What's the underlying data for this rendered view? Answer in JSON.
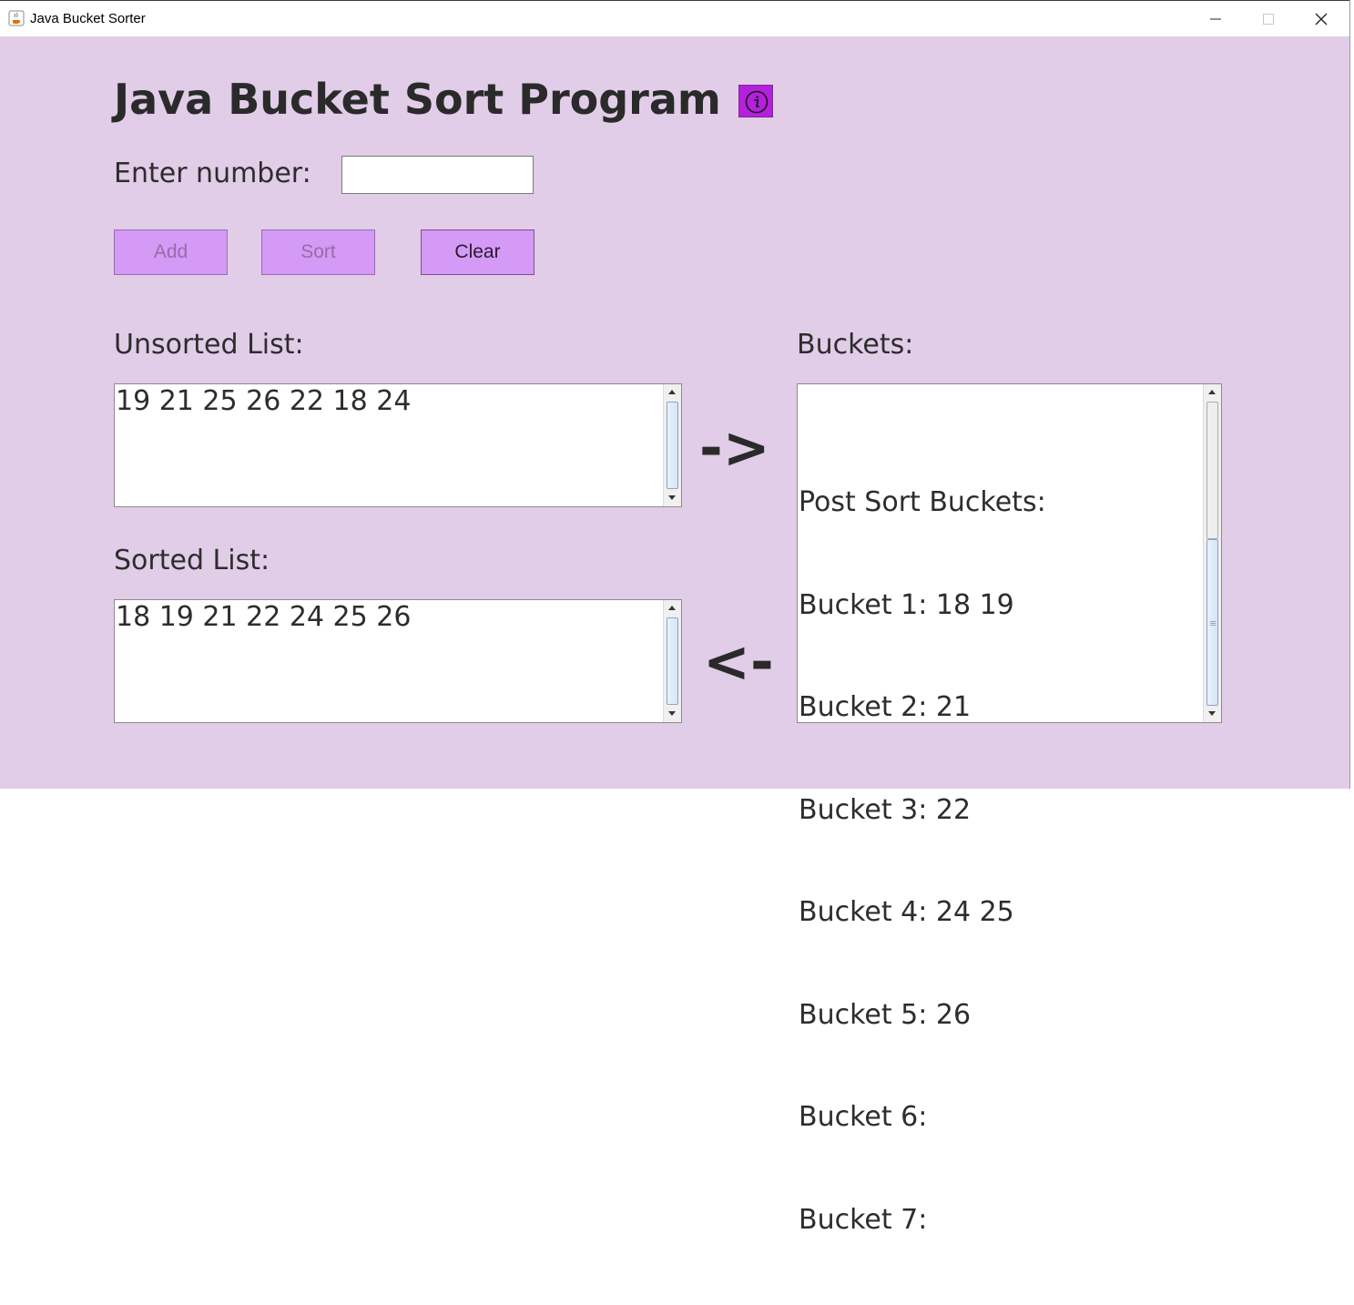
{
  "window": {
    "title": "Java Bucket Sorter",
    "icons": [
      "java-coffee-icon",
      "minimize-icon",
      "maximize-icon",
      "close-icon"
    ]
  },
  "header": {
    "title": "Java Bucket Sort Program",
    "info_icon": "info-circle-icon",
    "info_color": "#b520dd"
  },
  "input": {
    "label": "Enter number:",
    "value": "",
    "placeholder": ""
  },
  "buttons": {
    "add": "Add",
    "sort": "Sort",
    "clear": "Clear",
    "add_enabled": false,
    "sort_enabled": false,
    "clear_enabled": true
  },
  "unsorted": {
    "label": "Unsorted List:",
    "text": "19 21 25 26 22 18 24"
  },
  "sorted": {
    "label": "Sorted List:",
    "text": "18 19 21 22 24 25 26"
  },
  "buckets": {
    "label": "Buckets:",
    "lines": [
      "Post Sort Buckets:",
      "Bucket 1: 18 19",
      "Bucket 2: 21",
      "Bucket 3: 22",
      "Bucket 4: 24 25",
      "Bucket 5: 26",
      "Bucket 6:",
      "Bucket 7:"
    ]
  },
  "arrows": {
    "to_buckets": "->",
    "from_buckets": "<-"
  },
  "colors": {
    "background": "#e1cde7",
    "button": "#d49af5",
    "text": "#2d2d2d"
  }
}
